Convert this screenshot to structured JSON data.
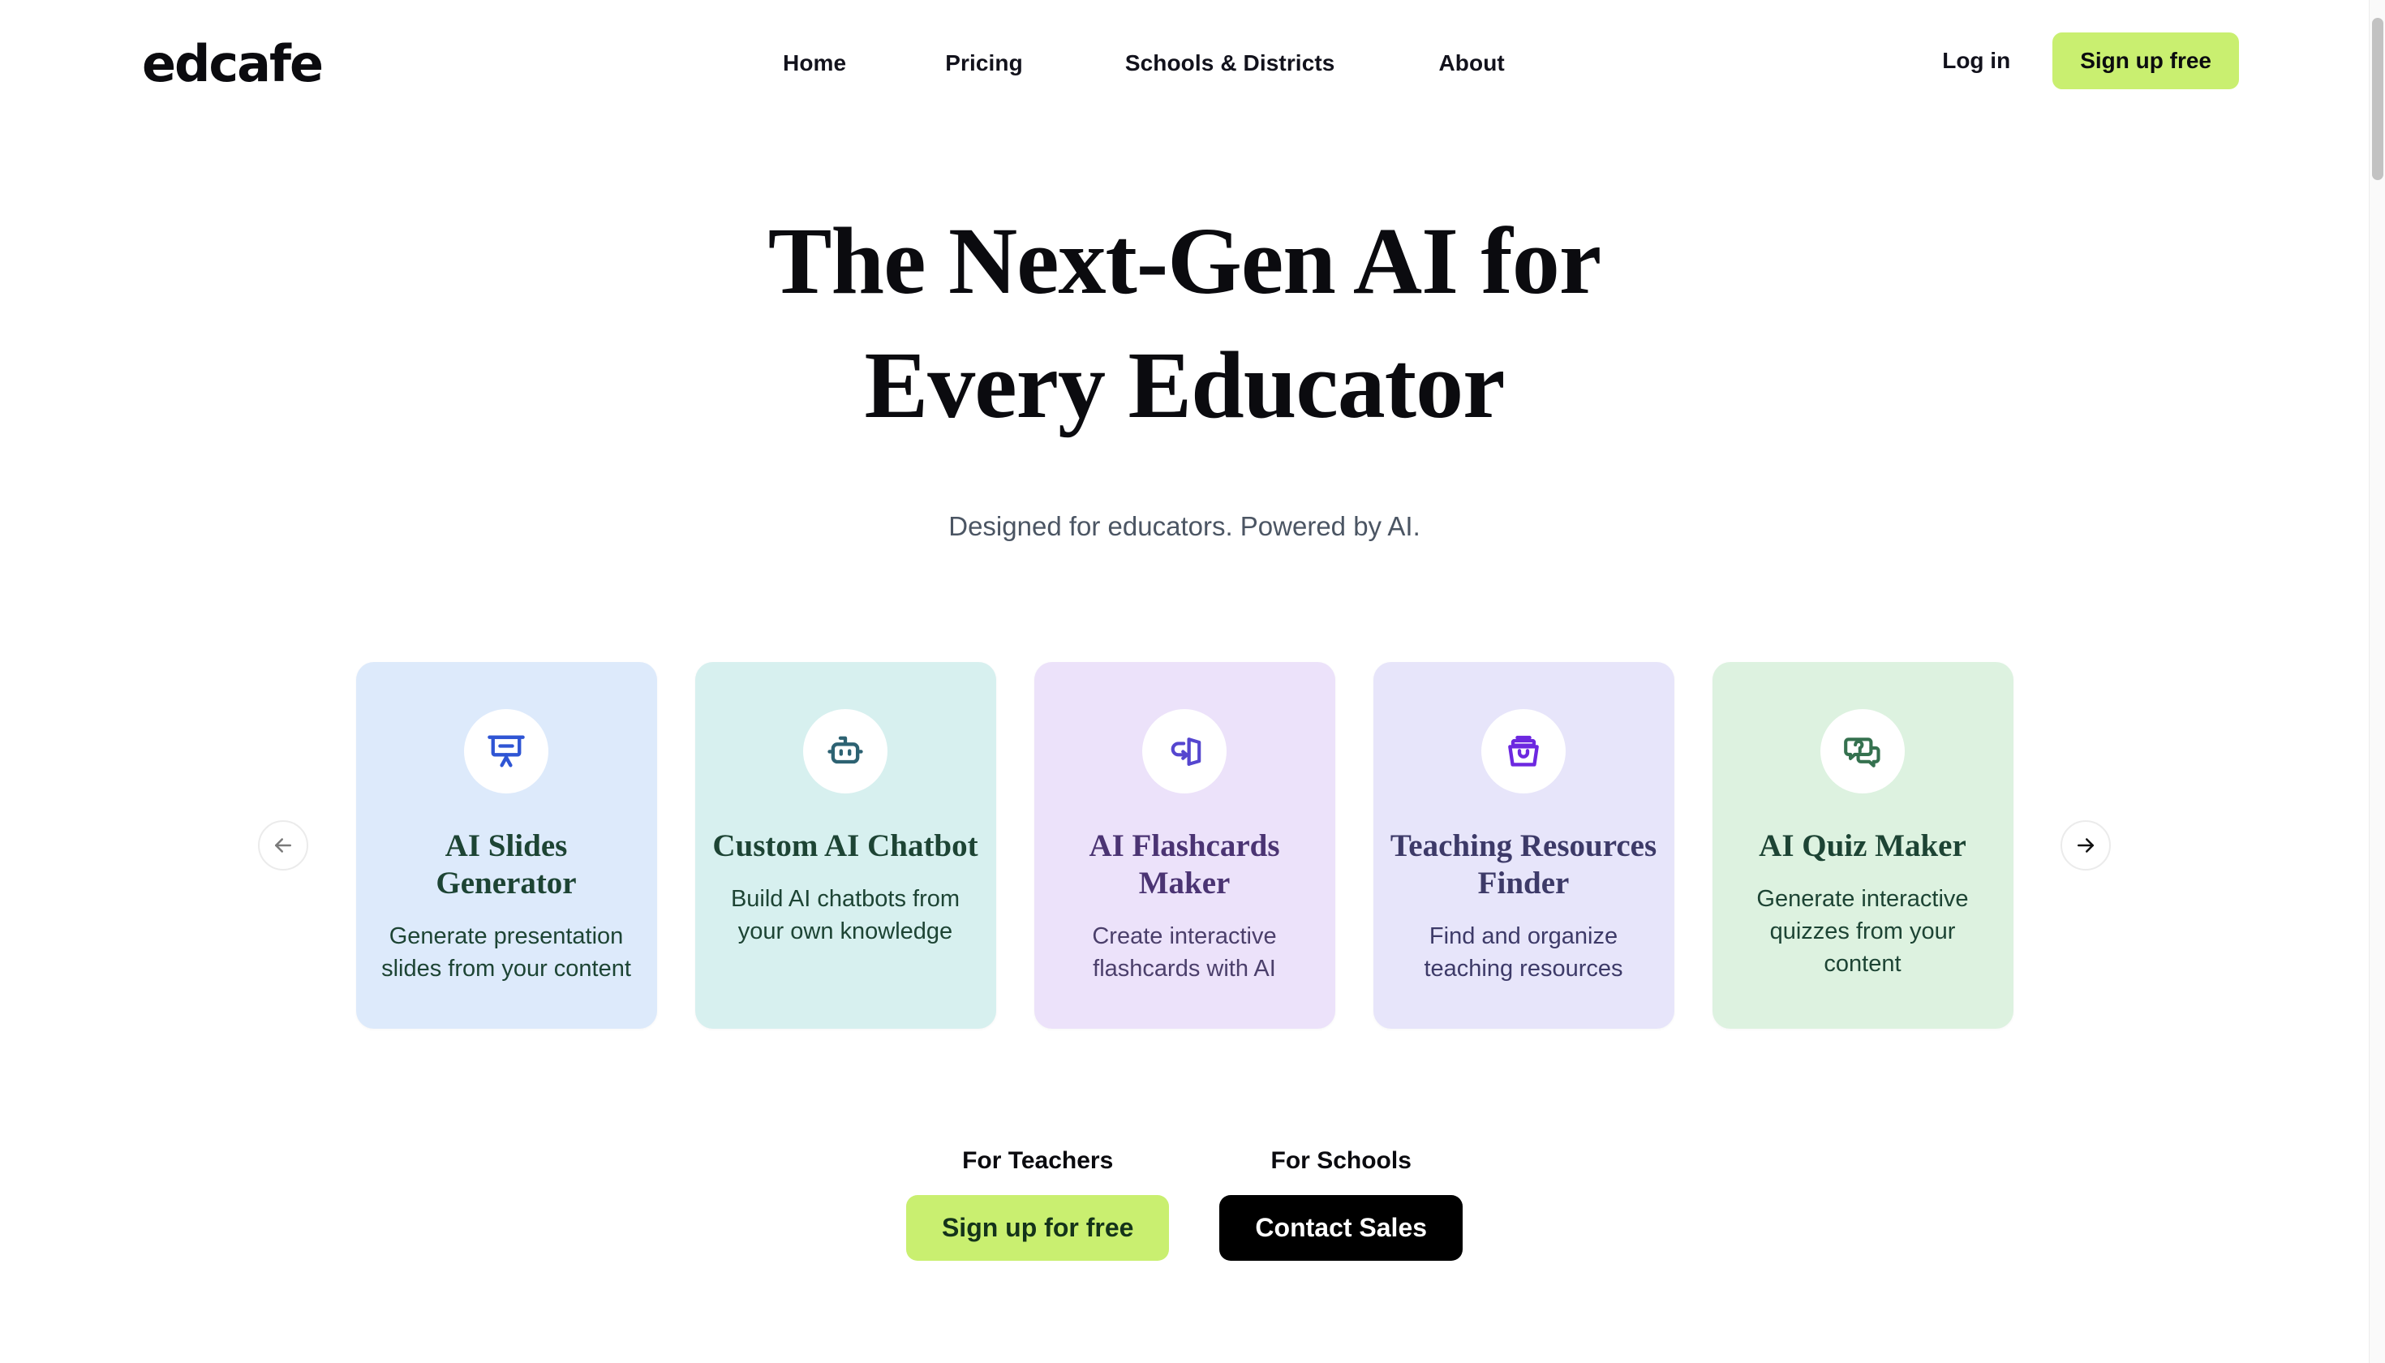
{
  "header": {
    "logo_text": "edcafe",
    "nav_items": [
      {
        "label": "Home"
      },
      {
        "label": "Pricing"
      },
      {
        "label": "Schools & Districts"
      },
      {
        "label": "About"
      }
    ],
    "login_label": "Log in",
    "signup_label": "Sign up free",
    "accent_color": "#c9ef70"
  },
  "hero": {
    "title_line1": "The Next-Gen AI for",
    "title_line2": "Every Educator",
    "subtitle": "Designed for educators. Powered by AI."
  },
  "carousel": {
    "prev_label": "←",
    "next_label": "→",
    "prev_icon": "arrow-left-icon",
    "next_icon": "arrow-right-icon",
    "cards": [
      {
        "title": "AI Slides Generator",
        "description": "Generate presentation slides from your content",
        "icon": "presentation-board-icon",
        "bg_color": "#ddeafb",
        "icon_color": "#2f55d4",
        "title_color": "#1d4434",
        "desc_color": "#1d4434"
      },
      {
        "title": "Custom AI Chatbot",
        "description": "Build AI chatbots from your own knowledge",
        "icon": "robot-icon",
        "bg_color": "#d7f0ef",
        "icon_color": "#2d6272",
        "title_color": "#1d4434",
        "desc_color": "#1d4434"
      },
      {
        "title": "AI Flashcards Maker",
        "description": "Create interactive flashcards with AI",
        "icon": "flashcard-flip-icon",
        "bg_color": "#ece2fa",
        "icon_color": "#5546cf",
        "title_color": "#4b3473",
        "desc_color": "#4b3f6b"
      },
      {
        "title": "Teaching Resources Finder",
        "description": "Find and organize teaching resources",
        "icon": "archive-box-icon",
        "bg_color": "#e7e5fa",
        "icon_color": "#6d28e0",
        "title_color": "#3d3a68",
        "desc_color": "#3d3a68"
      },
      {
        "title": "AI Quiz Maker",
        "description": "Generate interactive quizzes from your content",
        "icon": "quiz-chat-bubbles-icon",
        "bg_color": "#ddf2e0",
        "icon_color": "#35714f",
        "title_color": "#1d4434",
        "desc_color": "#1d4434"
      }
    ]
  },
  "cta": {
    "teachers_label": "For Teachers",
    "teachers_button": "Sign up for free",
    "schools_label": "For Schools",
    "schools_button": "Contact Sales"
  }
}
